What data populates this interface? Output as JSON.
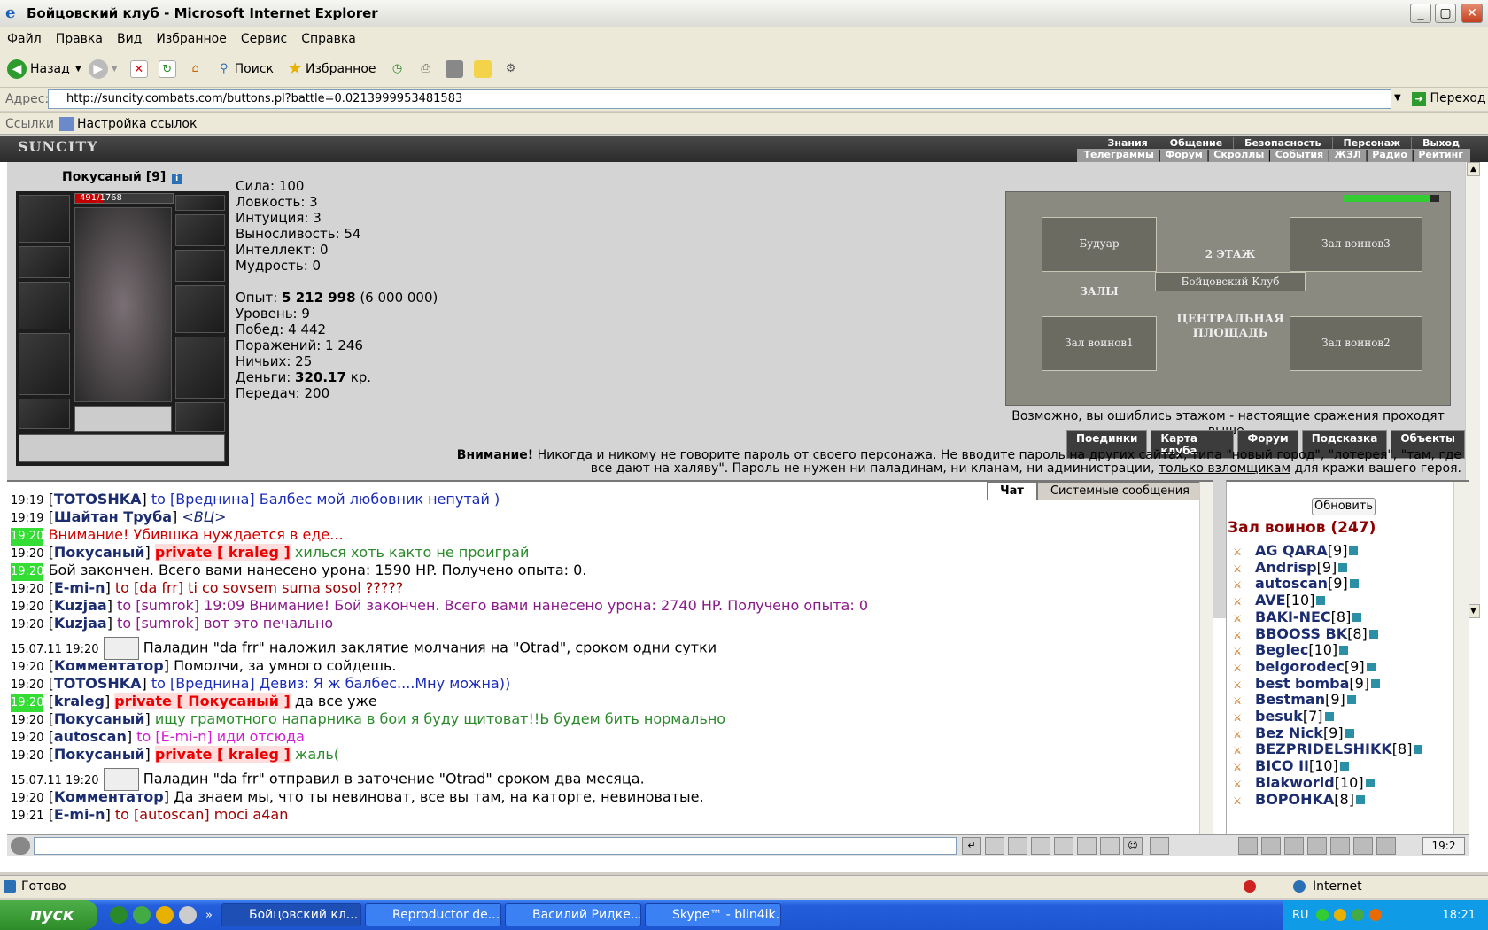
{
  "window": {
    "title": "Бойцовский клуб - Microsoft Internet Explorer"
  },
  "menu": [
    "Файл",
    "Правка",
    "Вид",
    "Избранное",
    "Сервис",
    "Справка"
  ],
  "toolbar": {
    "back": "Назад",
    "search": "Поиск",
    "favorites": "Избранное"
  },
  "address": {
    "label": "Адрес:",
    "url": "http://suncity.combats.com/buttons.pl?battle=0.0213999953481583",
    "go": "Переход"
  },
  "links": {
    "label": "Ссылки",
    "item": "Настройка ссылок"
  },
  "site": {
    "logo": "SUNCITY",
    "nav_main": [
      "Знания",
      "Общение",
      "Безопасность",
      "Персонаж",
      "Выход"
    ],
    "nav_sub": [
      "Телеграммы",
      "Форум",
      "Скроллы",
      "События",
      "ЖЗЛ",
      "Радио",
      "Рейтинг"
    ]
  },
  "character": {
    "name": "Покусаный [9]",
    "hp": "491/1768",
    "hp_fraction": 0.278,
    "stats": [
      "Сила: 100",
      "Ловкость: 3",
      "Интуиция: 3",
      "Выносливость: 54",
      "Интеллект: 0",
      "Мудрость: 0"
    ],
    "exp_label": "Опыт: ",
    "exp_value": "5 212 998",
    "exp_next": " (6 000 000)",
    "level": "Уровень: 9",
    "wins": "Побед: 4 442",
    "losses": "Поражений: 1 246",
    "draws": "Ничьих: 25",
    "money_label": "Деньги: ",
    "money_value": "320.17",
    "money_unit": " кр.",
    "transfers": "Передач: 200"
  },
  "map": {
    "rooms": [
      "Будуар",
      "Зал воинов3",
      "2 ЭТАЖ",
      "Бойцовский Клуб",
      "ЗАЛЫ",
      "ЦЕНТРАЛЬНАЯ ПЛОЩАДЬ",
      "Зал воинов1",
      "Зал воинов2"
    ],
    "note": "Возможно, вы ошиблись этажом - настоящие сражения проходят выше."
  },
  "actions": [
    "Поединки",
    "Карта клуба",
    "Форум",
    "Подсказка",
    "Объекты"
  ],
  "warning": {
    "bold": "Внимание!",
    "text": " Никогда и никому не говорите пароль от своего персонажа. Не вводите пароль на других сайтах, типа \"новый город\", \"лотерея\", \"там, где все дают на халяву\". Пароль не нужен ни паладинам, ни кланам, ни администрации, ",
    "link": "только взломщикам",
    "tail": " для кражи вашего героя."
  },
  "chat_tabs": [
    "Чат",
    "Системные сообщения"
  ],
  "chat": [
    {
      "time": "19:19",
      "hl": false,
      "name": "TOTOSHKA",
      "to": "to [Вреднина]",
      "text": " Балбес мой любовник непутай )",
      "color": "#1b2cb8"
    },
    {
      "time": "19:19",
      "hl": false,
      "name": "Шайтан Труба",
      "to": "",
      "text": " <ВЦ>",
      "color": "#1b2c6f",
      "italic": true
    },
    {
      "time": "19:20",
      "hl": true,
      "name": "",
      "to": "",
      "text": "Внимание! Убившка нуждается в еде...",
      "color": "#c00",
      "raw": true
    },
    {
      "time": "19:20",
      "hl": false,
      "name": "Покусаный",
      "to": "private [ kraleg ]",
      "text": " хилься хоть както не проиграй",
      "color": "#2a8a2a",
      "private": true
    },
    {
      "time": "19:20",
      "hl": true,
      "name": "",
      "to": "",
      "text": "Бой закончен. Всего вами нанесено урона: 1590 HP. Получено опыта: 0.",
      "color": "#000",
      "sys": true
    },
    {
      "time": "19:20",
      "hl": false,
      "name": "E-mi-n",
      "to": "to [da frr]",
      "text": " ti co sovsem suma sosol ?????",
      "color": "#a00000"
    },
    {
      "time": "19:20",
      "hl": false,
      "name": "Kuzjaa",
      "to": "to [sumrok]",
      "text": " 19:09 Внимание! Бой закончен. Всего вами нанесено урона: 2740 HP. Получено опыта: 0",
      "color": "#8a1a8a"
    },
    {
      "time": "19:20",
      "hl": false,
      "name": "Kuzjaa",
      "to": "to [sumrok]",
      "text": " вот это печально",
      "color": "#8a1a8a"
    },
    {
      "time": "15.07.11 19:20",
      "hl": false,
      "name": "",
      "to": "",
      "text": "Паладин \"da frr\" наложил заклятие молчания на \"Otrad\", сроком одни сутки",
      "color": "#000",
      "paladin": true
    },
    {
      "time": "19:20",
      "hl": false,
      "name": "Комментатор",
      "to": "",
      "text": " Помолчи, за умного сойдешь.",
      "color": "#000"
    },
    {
      "time": "19:20",
      "hl": false,
      "name": "TOTOSHKA",
      "to": "to [Вреднина]",
      "text": " Девиз: Я ж балбес....Мну можна))",
      "color": "#1b2cb8"
    },
    {
      "time": "19:20",
      "hl": true,
      "name": "kraleg",
      "to": "private [ Покусаный ]",
      "text": " да все уже",
      "color": "#000",
      "private": true
    },
    {
      "time": "19:20",
      "hl": false,
      "name": "Покусаный",
      "to": "",
      "text": " ищу грамотного напарника в бои я буду щитоват!!Ь будем бить нормально",
      "color": "#2a8a2a"
    },
    {
      "time": "19:20",
      "hl": false,
      "name": "autoscan",
      "to": "to [E-mi-n]",
      "text": " иди отсюда",
      "color": "#d020d0"
    },
    {
      "time": "19:20",
      "hl": false,
      "name": "Покусаный",
      "to": "private [ kraleg ]",
      "text": " жаль(",
      "color": "#2a8a2a",
      "private": true
    },
    {
      "time": "15.07.11 19:20",
      "hl": false,
      "name": "",
      "to": "",
      "text": "Паладин \"da frr\" отправил в заточение \"Otrad\" сроком два месяца.",
      "color": "#000",
      "paladin": true
    },
    {
      "time": "19:20",
      "hl": false,
      "name": "Комментатор",
      "to": "",
      "text": " Да знаем мы, что ты невиноват, все вы там, на каторге, невиноватые.",
      "color": "#000"
    },
    {
      "time": "19:21",
      "hl": false,
      "name": "E-mi-n",
      "to": "to [autoscan]",
      "text": " moci a4an",
      "color": "#a00000"
    }
  ],
  "userlist": {
    "refresh": "Обновить",
    "hall": "Зал воинов (247)",
    "users": [
      {
        "name": "AG QARA",
        "lvl": "[9]"
      },
      {
        "name": "Andrisp",
        "lvl": "[9]"
      },
      {
        "name": "autoscan",
        "lvl": "[9]"
      },
      {
        "name": "AVE",
        "lvl": "[10]"
      },
      {
        "name": "BAKI-NEC",
        "lvl": "[8]"
      },
      {
        "name": "BBOOSS BK",
        "lvl": "[8]"
      },
      {
        "name": "Beglec",
        "lvl": "[10]"
      },
      {
        "name": "belgorodec",
        "lvl": "[9]"
      },
      {
        "name": "best bomba",
        "lvl": "[9]"
      },
      {
        "name": "Bestman",
        "lvl": "[9]"
      },
      {
        "name": "besuk",
        "lvl": "[7]"
      },
      {
        "name": "Bez Nick",
        "lvl": "[9]"
      },
      {
        "name": "BEZPRIDELSHIKK",
        "lvl": "[8]"
      },
      {
        "name": "BICO II",
        "lvl": "[10]"
      },
      {
        "name": "Blakworld",
        "lvl": "[10]"
      },
      {
        "name": "BOPOHKA",
        "lvl": "[8]"
      }
    ]
  },
  "clock": "19:2",
  "status": {
    "ready": "Готово",
    "zone": "Internet"
  },
  "taskbar": {
    "start": "пуск",
    "tasks": [
      "Бойцовский кл...",
      "Reproductor de...",
      "Василий Ридке...",
      "Skype™ - blin4ik..."
    ],
    "lang": "RU",
    "time": "18:21"
  }
}
